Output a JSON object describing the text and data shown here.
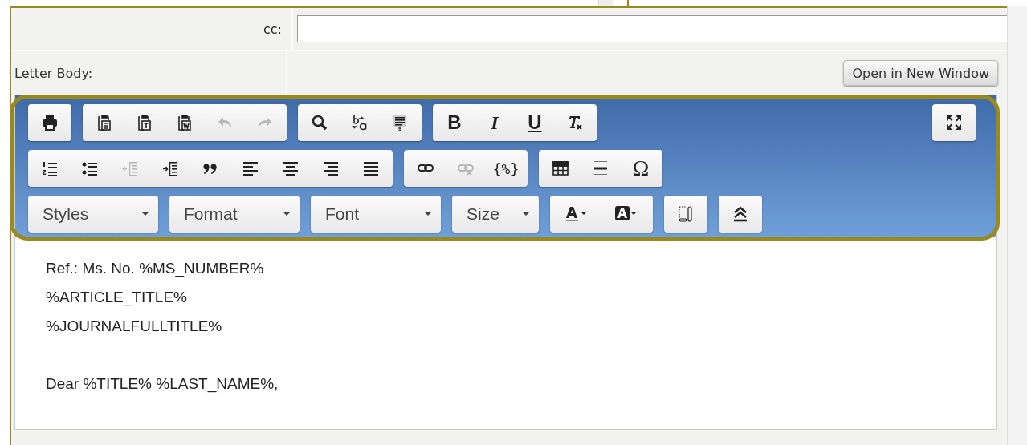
{
  "cc": {
    "label": "cc:"
  },
  "letter_body": {
    "label": "Letter Body:",
    "button": "Open in New Window"
  },
  "toolbar": {
    "rows": [
      [
        {
          "buttons": [
            {
              "disabled": false
            }
          ]
        },
        {
          "buttons": [
            {
              "disabled": false
            },
            {
              "disabled": false
            },
            {
              "disabled": false
            },
            {
              "disabled": true
            },
            {
              "disabled": true
            }
          ]
        },
        {
          "buttons": [
            {
              "disabled": false
            },
            {
              "disabled": false
            },
            {
              "disabled": false
            }
          ]
        },
        {
          "buttons": [
            {
              "glyph": "B",
              "disabled": false
            },
            {
              "glyph": "I",
              "disabled": false
            },
            {
              "glyph": "U",
              "disabled": false
            },
            {
              "disabled": false
            }
          ]
        },
        {
          "buttons": [
            {
              "disabled": false
            }
          ]
        }
      ],
      [
        {
          "buttons": [
            {
              "disabled": false
            },
            {
              "disabled": false
            },
            {
              "disabled": true
            },
            {
              "disabled": false
            },
            {
              "disabled": false
            },
            {
              "disabled": false
            },
            {
              "disabled": false
            },
            {
              "disabled": false
            },
            {
              "disabled": false
            }
          ]
        },
        {
          "buttons": [
            {
              "disabled": false
            },
            {
              "disabled": true
            },
            {
              "glyph": "{%}",
              "disabled": false
            }
          ]
        },
        {
          "buttons": [
            {
              "disabled": false
            },
            {
              "disabled": false
            },
            {
              "glyph": "Ω",
              "disabled": false
            }
          ]
        }
      ],
      [
        {
          "combo": "Styles"
        },
        {
          "combo": "Format"
        },
        {
          "combo": "Font"
        },
        {
          "combo": "Size"
        },
        {
          "buttons": [
            {
              "disabled": false
            },
            {
              "disabled": false
            }
          ]
        },
        {
          "buttons": [
            {
              "disabled": false
            }
          ]
        },
        {
          "buttons": [
            {
              "disabled": false
            }
          ]
        }
      ]
    ]
  },
  "body_paragraphs": [
    [
      "Ref.: Ms. No. %MS_NUMBER%",
      "%ARTICLE_TITLE%",
      "%JOURNALFULLTITLE%"
    ],
    [
      "Dear %TITLE% %LAST_NAME%,"
    ]
  ]
}
